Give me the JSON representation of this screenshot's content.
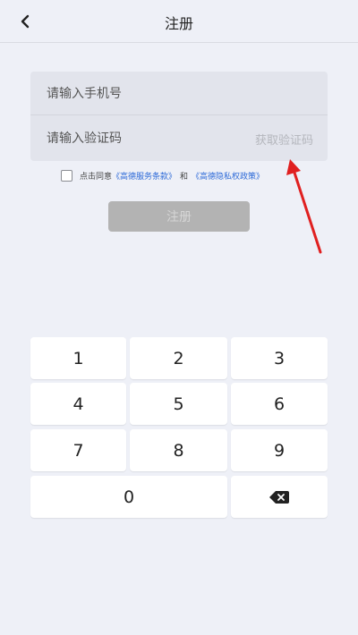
{
  "header": {
    "title": "注册"
  },
  "form": {
    "phone_placeholder": "请输入手机号",
    "code_placeholder": "请输入验证码",
    "get_code_label": "获取验证码"
  },
  "agreement": {
    "prefix": "点击同意",
    "terms_link": "《高德服务条款》",
    "conjunction": "和",
    "privacy_link": "《高德隐私权政策》",
    "checked": false
  },
  "register_label": "注册",
  "keypad": {
    "k1": "1",
    "k2": "2",
    "k3": "3",
    "k4": "4",
    "k5": "5",
    "k6": "6",
    "k7": "7",
    "k8": "8",
    "k9": "9",
    "k0": "0"
  },
  "colors": {
    "background": "#eef0f7",
    "link": "#2f6bd8",
    "annotation_arrow": "#e02020",
    "register_disabled": "#b3b3b3"
  }
}
